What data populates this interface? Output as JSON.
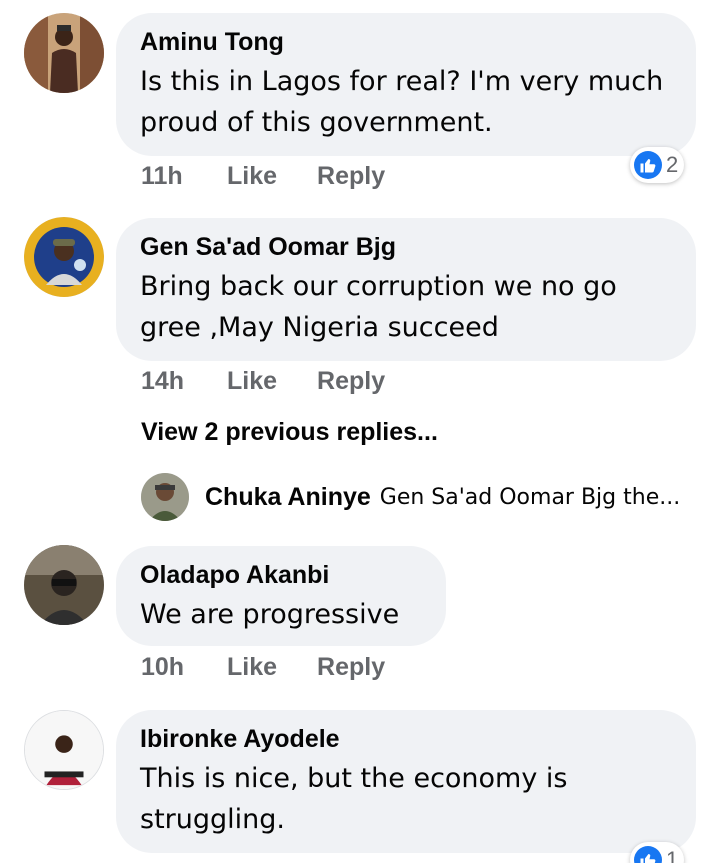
{
  "comments": [
    {
      "author": "Aminu Tong",
      "text": "Is this in Lagos for real? I'm very much proud of this government.",
      "time": "11h",
      "like_label": "Like",
      "reply_label": "Reply",
      "reaction_count": "2"
    },
    {
      "author": "Gen Sa'ad Oomar Bjg",
      "text": "Bring back our corruption we no go gree ,May Nigeria succeed",
      "time": "14h",
      "like_label": "Like",
      "reply_label": "Reply"
    },
    {
      "author": "Oladapo Akanbi",
      "text": "We are progressive",
      "time": "10h",
      "like_label": "Like",
      "reply_label": "Reply"
    },
    {
      "author": "Ibironke Ayodele",
      "text": "This is nice, but the economy is struggling.",
      "reaction_count": "1"
    }
  ],
  "replies": {
    "view_previous": "View 2 previous replies...",
    "latest": {
      "author": "Chuka Aninye",
      "preview": "Gen Sa'ad Oomar Bjg the..."
    }
  },
  "colors": {
    "bubble": "#f0f2f5",
    "meta_text": "#65676b",
    "like_blue": "#1877f2"
  },
  "icons": {
    "reaction": "thumbs-up-icon"
  }
}
